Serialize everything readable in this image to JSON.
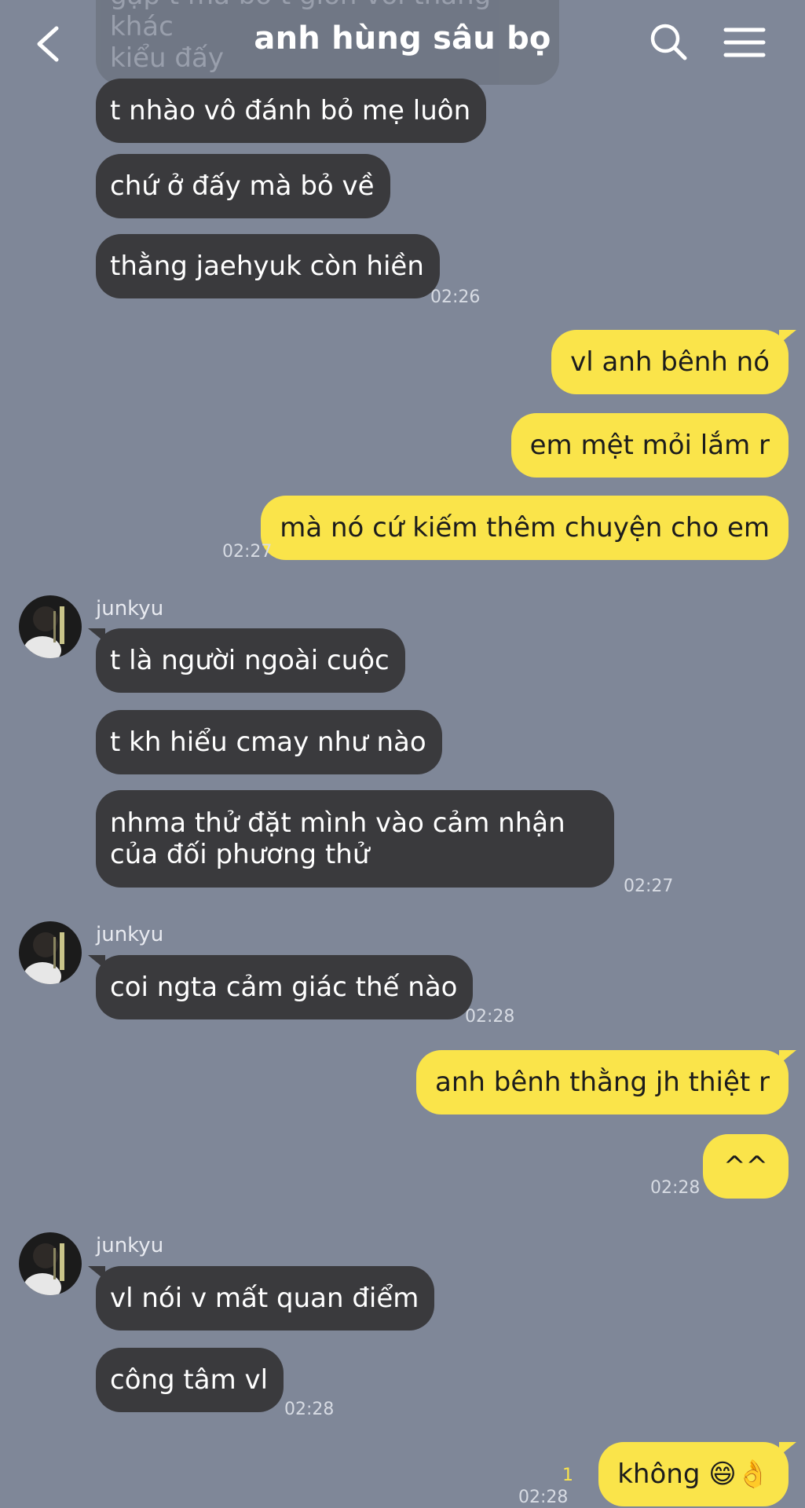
{
  "header": {
    "title": "anh hùng sâu bọ",
    "back_icon": "chevron-left-icon",
    "search_icon": "search-icon",
    "menu_icon": "hamburger-menu-icon"
  },
  "colors": {
    "background": "#7f8798",
    "incoming_bubble": "#3a3a3d",
    "outgoing_bubble": "#fae44a"
  },
  "top_partial_message": "gặp t mà bỏ t giờn với thằng khác\nkiểu đấy",
  "messages": [
    {
      "dir": "in",
      "text": "t nhào vô đánh bỏ mẹ luôn"
    },
    {
      "dir": "in",
      "text": "chứ ở đấy mà bỏ về"
    },
    {
      "dir": "in",
      "text": "thằng jaehyuk còn hiền",
      "time": "02:26"
    },
    {
      "dir": "out",
      "text": "vl anh bênh nó"
    },
    {
      "dir": "out",
      "text": "em mệt mỏi lắm r"
    },
    {
      "dir": "out",
      "text": "mà nó cứ kiếm thêm chuyện cho em",
      "time": "02:27"
    },
    {
      "dir": "in",
      "sender": "junkyu",
      "text": "t là người ngoài cuộc"
    },
    {
      "dir": "in",
      "text": "t kh hiểu cmay như nào"
    },
    {
      "dir": "in",
      "text": "nhma thử đặt mình vào cảm nhận của đối phương thử",
      "time": "02:27"
    },
    {
      "dir": "in",
      "sender": "junkyu",
      "text": "coi ngta cảm giác thế nào",
      "time": "02:28"
    },
    {
      "dir": "out",
      "text": "anh bênh thằng jh thiệt r"
    },
    {
      "dir": "out",
      "text": "^^",
      "time": "02:28"
    },
    {
      "dir": "in",
      "sender": "junkyu",
      "text": "vl nói v mất quan điểm"
    },
    {
      "dir": "in",
      "text": "công tâm vl",
      "time": "02:28"
    },
    {
      "dir": "out",
      "text": "không 😄👌",
      "time": "02:28",
      "unread": "1"
    }
  ]
}
